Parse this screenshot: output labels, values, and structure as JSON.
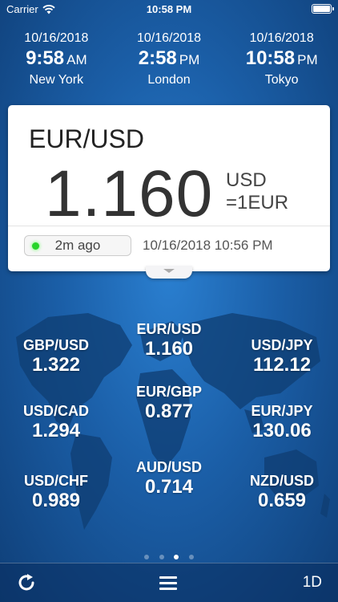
{
  "status": {
    "carrier": "Carrier",
    "time": "10:58 PM"
  },
  "clocks": [
    {
      "date": "10/16/2018",
      "time": "9:58",
      "ampm": "AM",
      "city": "New York"
    },
    {
      "date": "10/16/2018",
      "time": "2:58",
      "ampm": "PM",
      "city": "London"
    },
    {
      "date": "10/16/2018",
      "time": "10:58",
      "ampm": "PM",
      "city": "Tokyo"
    }
  ],
  "main": {
    "pair": "EUR/USD",
    "rate": "1.160",
    "unit_line1": "USD",
    "unit_line2": "=1EUR",
    "updated_ago": "2m ago",
    "updated_at": "10/16/2018 10:56 PM"
  },
  "rates": [
    {
      "pair": "EUR/USD",
      "value": "1.160"
    },
    {
      "pair": "GBP/USD",
      "value": "1.322"
    },
    {
      "pair": "USD/JPY",
      "value": "112.12"
    },
    {
      "pair": "EUR/GBP",
      "value": "0.877"
    },
    {
      "pair": "USD/CAD",
      "value": "1.294"
    },
    {
      "pair": "EUR/JPY",
      "value": "130.06"
    },
    {
      "pair": "AUD/USD",
      "value": "0.714"
    },
    {
      "pair": "USD/CHF",
      "value": "0.989"
    },
    {
      "pair": "NZD/USD",
      "value": "0.659"
    }
  ],
  "pager": {
    "count": 4,
    "active": 2
  },
  "toolbar": {
    "refresh_icon": "refresh-icon",
    "menu_icon": "menu-icon",
    "period": "1D"
  },
  "colors": {
    "background": "#1b5fa8",
    "card": "#ffffff",
    "live_dot": "#27d42a"
  }
}
